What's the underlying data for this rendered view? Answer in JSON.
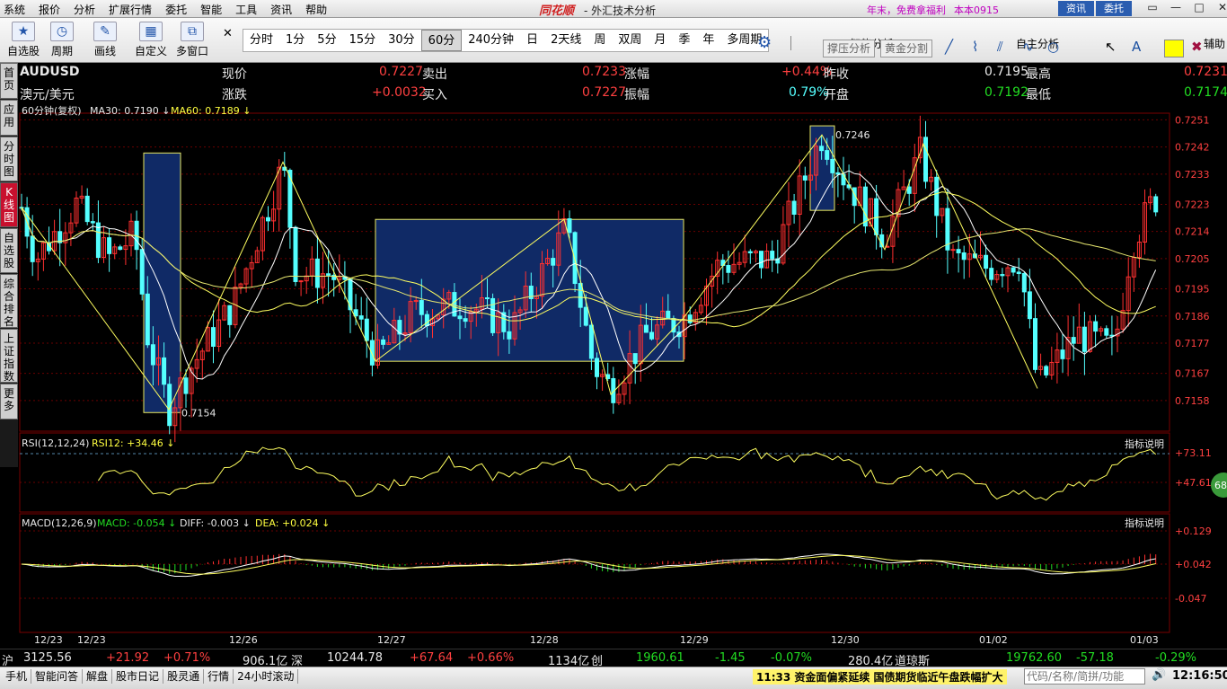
{
  "menu": [
    "系统",
    "报价",
    "分析",
    "扩展行情",
    "委托",
    "智能",
    "工具",
    "资讯",
    "帮助"
  ],
  "brand": "同花顺",
  "app_title": "- 外汇技术分析",
  "promo": "年末，免费拿福利",
  "version": "本本0915",
  "btn_zixun": "资讯",
  "btn_weituo": "委托",
  "window_controls": [
    "▭",
    "—",
    "□",
    "✕"
  ],
  "toolbar": {
    "buttons": [
      {
        "label": "自选股",
        "icon": "star-icon"
      },
      {
        "label": "周期",
        "icon": "clock-icon"
      },
      {
        "label": "画线",
        "icon": "pen-icon"
      },
      {
        "label": "自定义",
        "icon": "grid-icon"
      },
      {
        "label": "多窗口",
        "icon": "windows-icon"
      }
    ],
    "periods": [
      "分时",
      "1分",
      "5分",
      "15分",
      "30分",
      "60分",
      "240分钟",
      "日",
      "2天线",
      "周",
      "双周",
      "月",
      "季",
      "年",
      "多周期"
    ],
    "active_period": "60分"
  },
  "right_panel": {
    "head1": "智能分析",
    "head2": "自主分析",
    "head3": "辅助",
    "btn1": "撑压分析",
    "btn2": "黄金分割"
  },
  "side_tabs": [
    "首页",
    "应用",
    "分时图",
    "K线图",
    "自选股",
    "综合排名",
    "上证指数",
    "更多"
  ],
  "quote": {
    "symbol": "AUDUSD",
    "name": "澳元/美元",
    "xianjia_label": "现价",
    "xianjia": "0.7227",
    "maichu_label": "卖出",
    "maichu": "0.7233",
    "zhangfu_label": "涨幅",
    "zhangfu": "+0.44%",
    "zuoshou_label": "昨收",
    "zuoshou": "0.7195",
    "zuigao_label": "最高",
    "zuigao": "0.7231",
    "zhangdie_label": "涨跌",
    "zhangdie": "+0.0032",
    "mairu_label": "买入",
    "mairu": "0.7227",
    "zhenfu_label": "振幅",
    "zhenfu": "0.79%",
    "kaipan_label": "开盘",
    "kaipan": "0.7192",
    "zuidi_label": "最低",
    "zuidi": "0.7174"
  },
  "chart_data": {
    "type": "candlestick",
    "price_legend": "60分钟(复权)",
    "ma30_label": "MA30: 0.7190",
    "ma60_label": "MA60: 0.7189",
    "y_ticks": [
      "0.7251",
      "0.7242",
      "0.7233",
      "0.7223",
      "0.7214",
      "0.7205",
      "0.7195",
      "0.7186",
      "0.7177",
      "0.7167",
      "0.7158"
    ],
    "ylim": [
      0.7152,
      0.7252
    ],
    "high_label": "0.7246",
    "low_label": "0.7154",
    "x_labels": [
      "12/23",
      "12/23",
      "12/26",
      "12/27",
      "12/28",
      "12/29",
      "12/30",
      "01/02",
      "01/03"
    ],
    "rsi_legend": "RSI(12,12,24)",
    "rsi_value": "RSI12: +34.46",
    "rsi_ticks": [
      "+73.11",
      "+47.61"
    ],
    "rsi_badge": "68",
    "macd_legend": "MACD(12,26,9)",
    "macd_value": "MACD: -0.054",
    "diff_value": "DIFF: -0.003",
    "dea_value": "DEA: +0.024",
    "macd_ticks": [
      "+0.129",
      "+0.042",
      "-0.047"
    ],
    "indicator_help": "指标说明",
    "colors": {
      "up": "#ff3030",
      "down": "#54ffff",
      "ma": "#ffff60",
      "grid": "#6a0000",
      "box": "#102a66"
    }
  },
  "statusbar": {
    "sh_label": "沪",
    "sh_val": "3125.56",
    "sh_chg": "+21.92",
    "sh_pct": "+0.71%",
    "sh_amt": "906.1亿",
    "sz_label": "深",
    "sz_val": "10244.78",
    "sz_chg": "+67.64",
    "sz_pct": "+0.66%",
    "sz_amt": "1134亿",
    "cy_label": "创",
    "cy_val": "1960.61",
    "cy_chg": "-1.45",
    "cy_pct": "-0.07%",
    "cy_amt": "280.4亿",
    "dj_label": "道琼斯",
    "dj_val": "19762.60",
    "dj_chg": "-57.18",
    "dj_pct": "-0.29%"
  },
  "bottom_tabs": [
    "手机",
    "智能问答",
    "解盘",
    "股市日记",
    "股灵通",
    "行情",
    "24小时滚动"
  ],
  "news": "11:33 资金面偏紧延续 国债期货临近午盘跌幅扩大",
  "code_placeholder": "代码/名称/简拼/功能",
  "clock": "12:16:50"
}
